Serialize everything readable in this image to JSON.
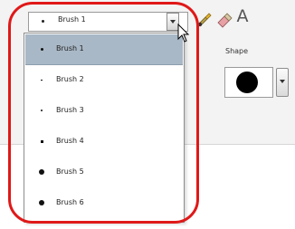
{
  "panel": {
    "shape_label": "Shape",
    "colors": {
      "background": "#f3f3f3",
      "highlight": "#e01818",
      "selected_row": "#a9b8c6"
    }
  },
  "tools": [
    {
      "icon": "brush-tool-icon"
    },
    {
      "icon": "eraser-tool-icon"
    },
    {
      "text": "A",
      "icon": "text-tool-icon"
    }
  ],
  "brush_combo": {
    "selected_label": "Brush 1"
  },
  "brush_list": [
    {
      "label": "Brush 1",
      "selected": true
    },
    {
      "label": "Brush 2",
      "selected": false
    },
    {
      "label": "Brush 3",
      "selected": false
    },
    {
      "label": "Brush 4",
      "selected": false
    },
    {
      "label": "Brush 5",
      "selected": false
    },
    {
      "label": "Brush 6",
      "selected": false
    }
  ]
}
